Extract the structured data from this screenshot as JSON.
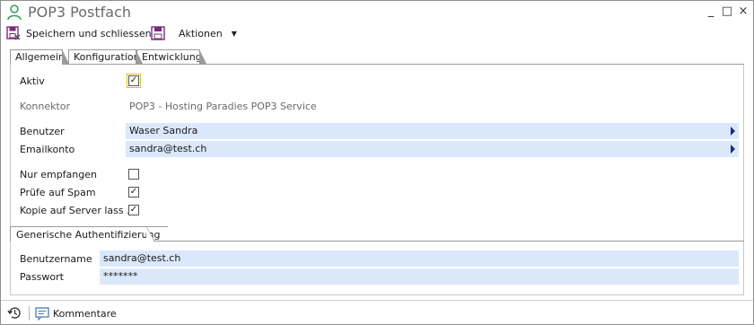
{
  "window": {
    "title": "POP3 Postfach",
    "minimize_glyph": "_",
    "maximize_glyph": "□",
    "close_glyph": "×"
  },
  "toolbar": {
    "save_close_label": "Speichern und schliessen",
    "actions_label": "Aktionen",
    "actions_arrow": "▼"
  },
  "tabs": [
    {
      "label": "Allgemein",
      "active": true
    },
    {
      "label": "Konfiguration",
      "active": false
    },
    {
      "label": "Entwicklung",
      "active": false
    }
  ],
  "general": {
    "aktiv_label": "Aktiv",
    "aktiv_checked": "✓",
    "konnektor_label": "Konnektor",
    "konnektor_value": "POP3 - Hosting Paradies POP3 Service",
    "benutzer_label": "Benutzer",
    "benutzer_value": "Waser Sandra",
    "emailkonto_label": "Emailkonto",
    "emailkonto_value": "sandra@test.ch",
    "nur_empfangen_label": "Nur empfangen",
    "nur_empfangen_checked": "",
    "spam_label": "Prüfe auf Spam",
    "spam_checked": "✓",
    "kopie_label": "Kopie auf  Server lass ...",
    "kopie_checked": "✓"
  },
  "auth": {
    "section_label": "Generische Authentifizierung",
    "username_label": "Benutzername",
    "username_value": "sandra@test.ch",
    "password_label": "Passwort",
    "password_value": "*******"
  },
  "footer": {
    "comments_label": "Kommentare"
  },
  "colors": {
    "field_bg": "#dbe8fb",
    "focus_outline": "#e6c200",
    "save_icon": "#7a2b7a",
    "user_icon": "#3aa05a"
  }
}
